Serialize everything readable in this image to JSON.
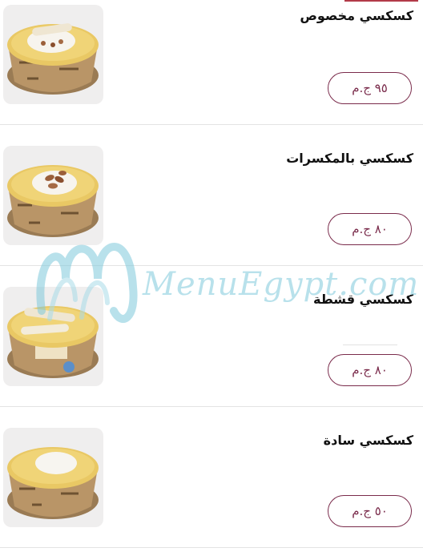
{
  "menu": {
    "items": [
      {
        "name": "كسكسي مخصوص",
        "price": "٩٥ ج.م"
      },
      {
        "name": "كسكسي بالمكسرات",
        "price": "٨٠ ج.م"
      },
      {
        "name": "كسكسي قشطة",
        "price": "٨٠ ج.م"
      },
      {
        "name": "كسكسي سادة",
        "price": "٥٠ ج.م"
      }
    ]
  },
  "watermark": {
    "text": "MenuEgypt.com"
  },
  "colors": {
    "accent": "#7a2b4b",
    "watermark": "#7fc9db",
    "divider": "#e3e3e3"
  }
}
